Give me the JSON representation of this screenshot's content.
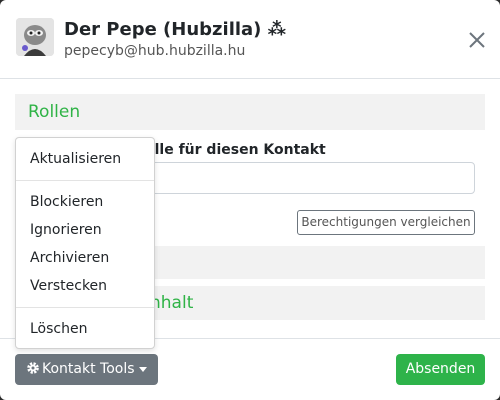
{
  "header": {
    "title": "Der Pepe (Hubzilla) ⁂",
    "subtitle": "pepecyb@hub.hubzilla.hu",
    "avatar_icon": "user-avatar-icon",
    "close_icon": "close-icon"
  },
  "sections": {
    "roles_title": "Rollen",
    "role_label_suffix": "olle für diesen Kontakt",
    "compare_button": "Berechtigungen vergleichen",
    "content_title_suffix": "nhalt"
  },
  "dropdown": {
    "items": [
      {
        "label": "Aktualisieren"
      },
      {
        "label": "Blockieren"
      },
      {
        "label": "Ignorieren"
      },
      {
        "label": "Archivieren"
      },
      {
        "label": "Verstecken"
      },
      {
        "label": "Löschen"
      }
    ]
  },
  "footer": {
    "tools_button": "Kontakt Tools",
    "tools_icon": "gear-icon",
    "submit_button": "Absenden"
  },
  "colors": {
    "accent_green": "#2fb346",
    "submit_green": "#2eb34a",
    "secondary_gray": "#6c757d"
  }
}
